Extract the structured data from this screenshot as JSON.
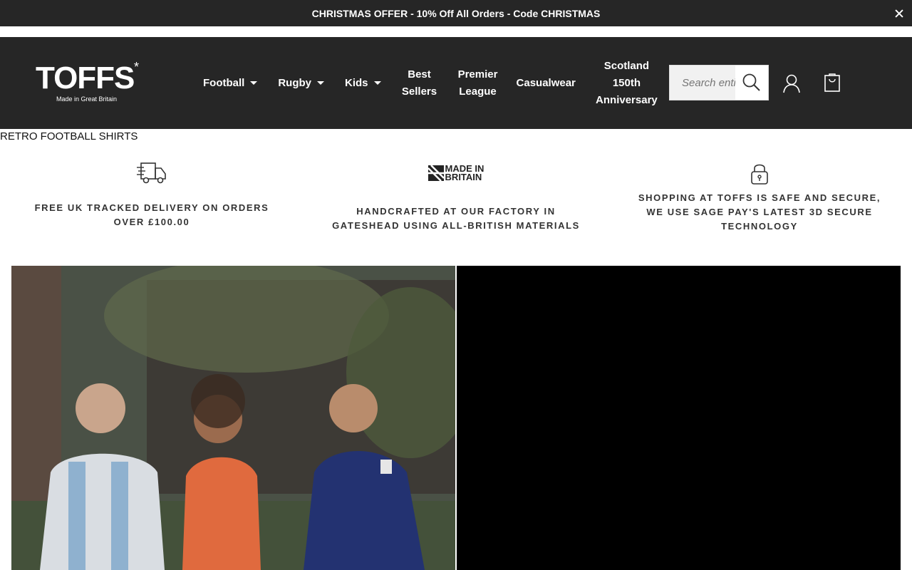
{
  "announcement": {
    "text": "CHRISTMAS OFFER - 10% Off All Orders - Code CHRISTMAS",
    "close_icon": "close-icon"
  },
  "header": {
    "logo_text": "TOFFS",
    "logo_star": "*",
    "logo_sub": "Made in Great Britain",
    "nav": [
      {
        "label": "Football",
        "dropdown": true
      },
      {
        "label": "Rugby",
        "dropdown": true
      },
      {
        "label": "Kids",
        "dropdown": true
      },
      {
        "label": "Best Sellers",
        "dropdown": false
      },
      {
        "label": "Premier League",
        "dropdown": false
      },
      {
        "label": "Casualwear",
        "dropdown": false
      },
      {
        "label": "Scotland 150th Anniversary",
        "dropdown": false
      }
    ],
    "search": {
      "placeholder": "Search entire store",
      "icon": "search-icon"
    },
    "account_icon": "user-icon",
    "cart_icon": "shopping-bag-icon"
  },
  "hero": {
    "alt_text": "RETRO FOOTBALL SHIRTS"
  },
  "usps": [
    {
      "icon": "delivery-truck-icon",
      "text": "FREE UK TRACKED DELIVERY ON ORDERS OVER £100.00"
    },
    {
      "icon": "made-in-britain-icon",
      "badge_line1": "MADE IN",
      "badge_line2": "BRITAIN",
      "text": "HANDCRAFTED AT OUR FACTORY IN GATESHEAD USING ALL-BRITISH MATERIALS"
    },
    {
      "icon": "padlock-icon",
      "text": "SHOPPING AT TOFFS IS SAFE AND SECURE, WE USE SAGE PAY'S LATEST 3D SECURE TECHNOLOGY"
    }
  ],
  "colors": {
    "header_bg": "#262626",
    "text": "#333333"
  }
}
